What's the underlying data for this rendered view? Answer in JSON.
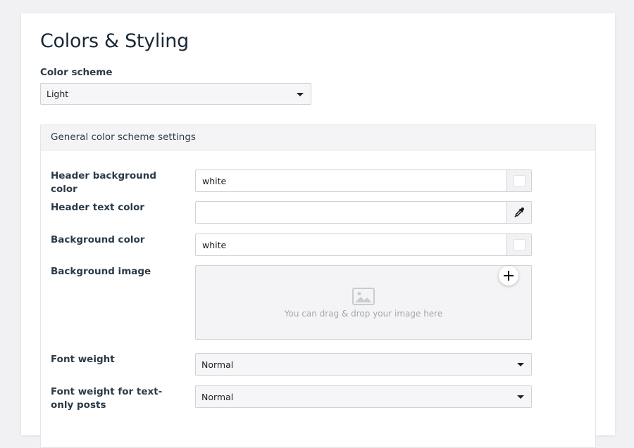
{
  "page": {
    "title": "Colors & Styling"
  },
  "color_scheme": {
    "label": "Color scheme",
    "value": "Light"
  },
  "panel": {
    "title": "General color scheme settings",
    "header_bg": {
      "label": "Header background color",
      "value": "white",
      "swatch": "#ffffff"
    },
    "header_text": {
      "label": "Header text color",
      "value": "",
      "icon": "eyedropper-icon"
    },
    "bg_color": {
      "label": "Background color",
      "value": "white",
      "swatch": "#ffffff"
    },
    "bg_image": {
      "label": "Background image",
      "hint": "You can drag & drop your image here",
      "icon": "image-icon",
      "add_icon": "plus-icon"
    },
    "font_weight": {
      "label": "Font weight",
      "value": "Normal"
    },
    "font_weight_text": {
      "label": "Font weight for text-only posts",
      "value": "Normal"
    }
  }
}
